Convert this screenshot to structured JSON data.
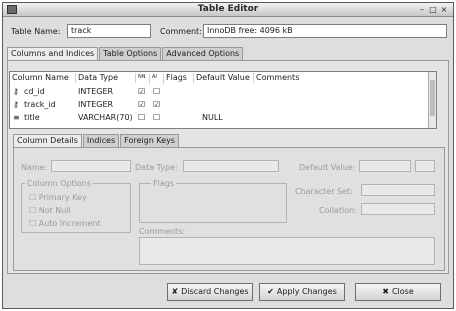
{
  "window": {
    "title": "Table Editor",
    "controls": [
      "–",
      "□",
      "×"
    ]
  },
  "top": {
    "table_name_label": "Table Name:",
    "table_name_value": "track",
    "comment_label": "Comment:",
    "comment_value": "InnoDB free: 4096 kB"
  },
  "tabs": [
    "Columns and Indices",
    "Table Options",
    "Advanced Options"
  ],
  "grid": {
    "headers": [
      "Column Name",
      "Data Type",
      "NN",
      "AI",
      "Flags",
      "Default Value",
      "Comments"
    ],
    "rows": [
      {
        "name": "cd_id",
        "type": "INTEGER",
        "nn": "☑",
        "ai": "☐",
        "default": ""
      },
      {
        "name": "track_id",
        "type": "INTEGER",
        "nn": "☑",
        "ai": "☑",
        "default": ""
      },
      {
        "name": "title",
        "type": "VARCHAR(70)",
        "nn": "☐",
        "ai": "☐",
        "default": "NULL"
      }
    ]
  },
  "subtabs": [
    "Column Details",
    "Indices",
    "Foreign Keys"
  ],
  "details": {
    "name_label": "Name:",
    "data_type_label": "Data Type:",
    "default_value_label": "Default Value:",
    "column_options_label": "Column Options",
    "flags_label": "Flags",
    "character_set_label": "Character Set:",
    "collation_label": "Collation:",
    "comments_label": "Comments:",
    "options": [
      "Primary Key",
      "Not Null",
      "Auto Increment"
    ]
  },
  "buttons": {
    "discard": "Discard Changes",
    "apply": "Apply Changes",
    "close": "Close"
  }
}
